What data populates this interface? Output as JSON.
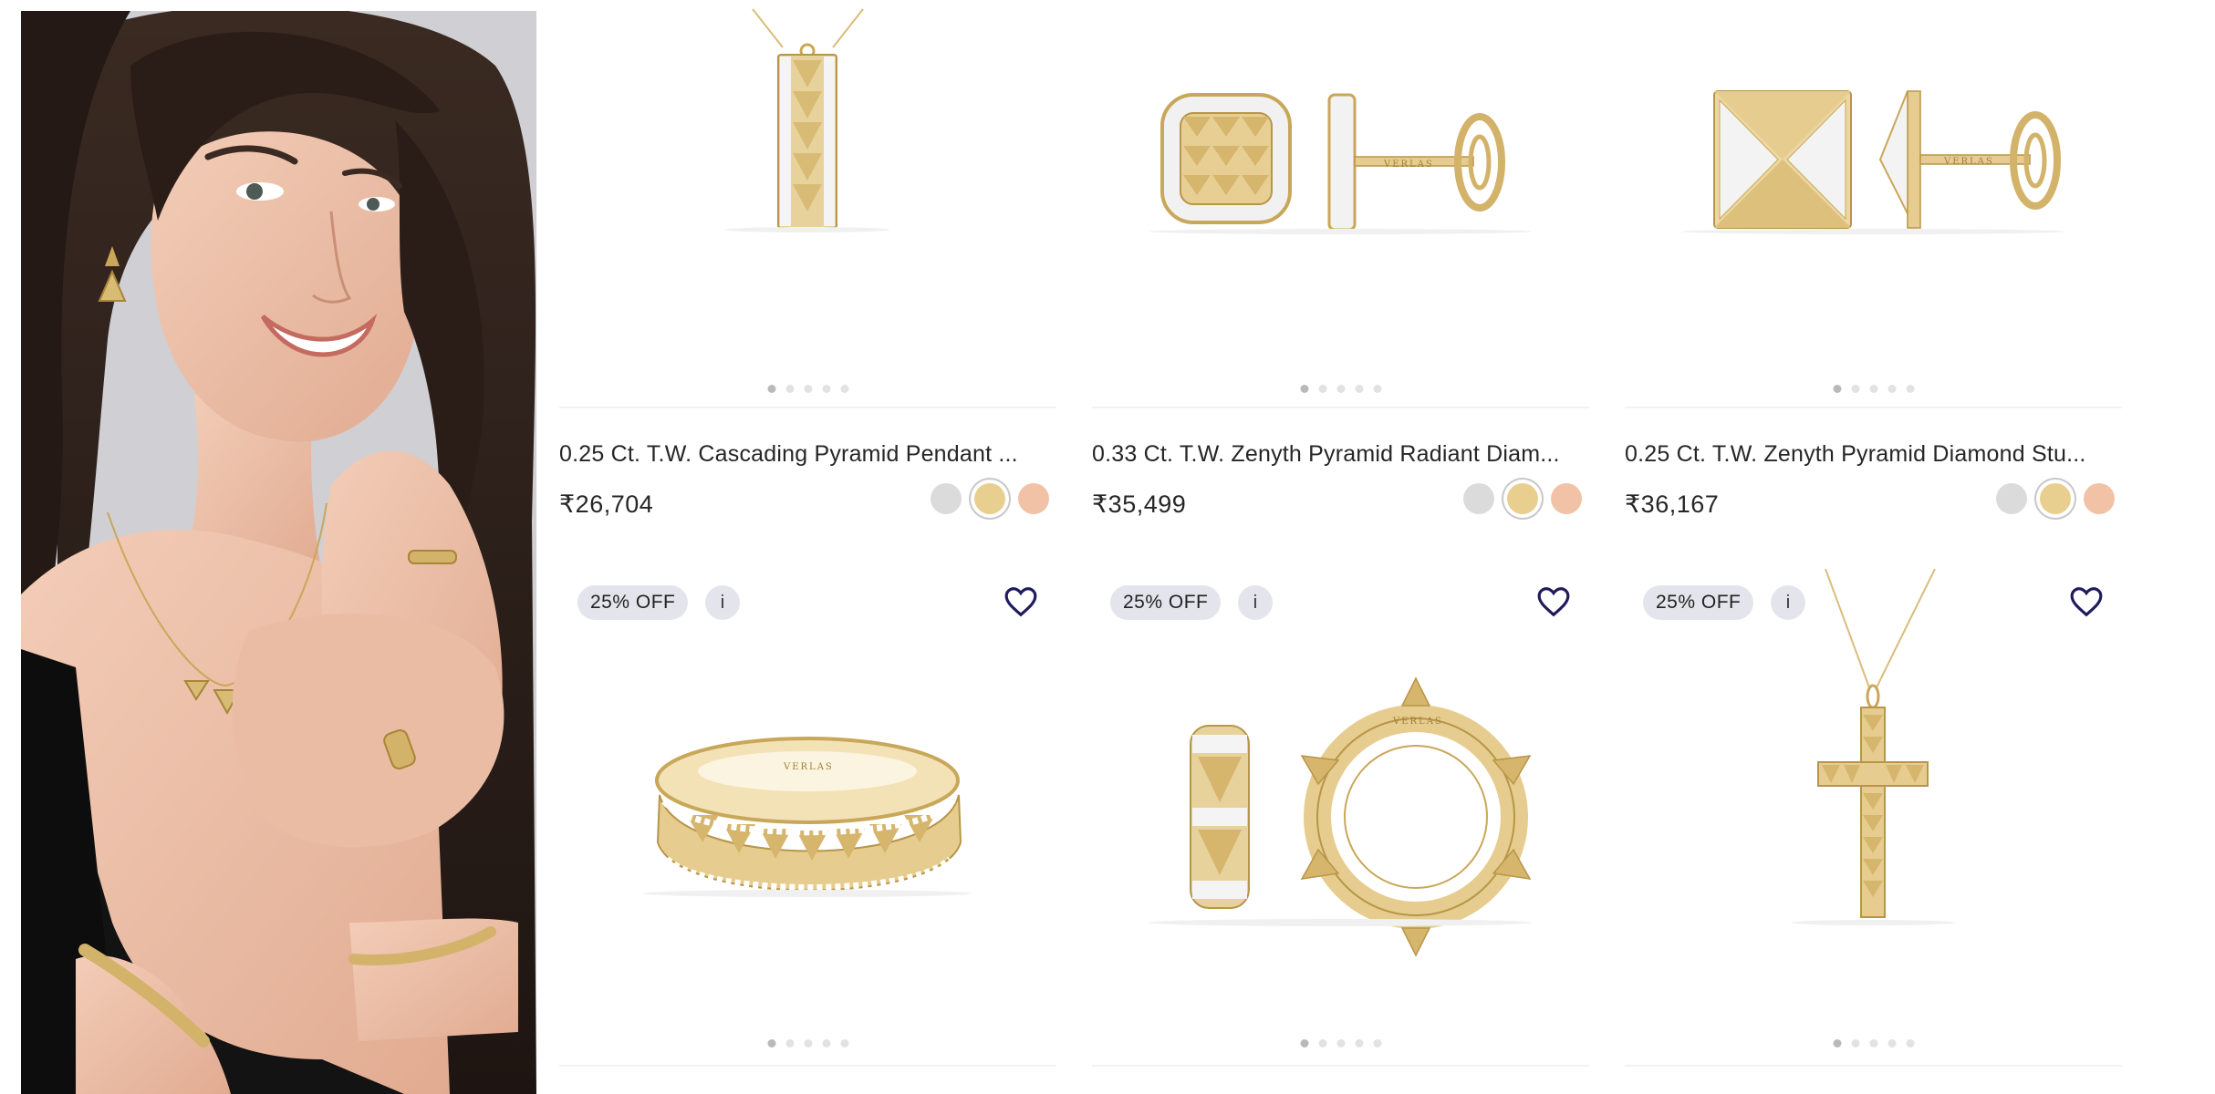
{
  "model_image": {
    "alt_name": "model-lifestyle-photo"
  },
  "colors": {
    "white_gold": "#dcdbdc",
    "yellow_gold": "#e9cf8f",
    "rose_gold": "#f2c2a7",
    "badge_bg": "#e4e5ec",
    "heart": "#1f1b5c"
  },
  "products_top": [
    {
      "title": "0.25 Ct. T.W. Cascading Pyramid Pendant ...",
      "price": "₹26,704",
      "image_dots": 5,
      "active_dot": 0,
      "selected_metal": "yellow-gold"
    },
    {
      "title": "0.33 Ct. T.W. Zenyth Pyramid Radiant Diam...",
      "price": "₹35,499",
      "image_dots": 5,
      "active_dot": 0,
      "selected_metal": "yellow-gold"
    },
    {
      "title": "0.25 Ct. T.W. Zenyth Pyramid Diamond Stu...",
      "price": "₹36,167",
      "image_dots": 5,
      "active_dot": 0,
      "selected_metal": "yellow-gold"
    }
  ],
  "products_bottom": [
    {
      "badge": "25% OFF",
      "info": "i",
      "image_dots": 5,
      "active_dot": 0,
      "icon": "heart-icon"
    },
    {
      "badge": "25% OFF",
      "info": "i",
      "image_dots": 5,
      "active_dot": 0,
      "icon": "heart-icon"
    },
    {
      "badge": "25% OFF",
      "info": "i",
      "image_dots": 5,
      "active_dot": 0,
      "icon": "heart-icon"
    }
  ]
}
